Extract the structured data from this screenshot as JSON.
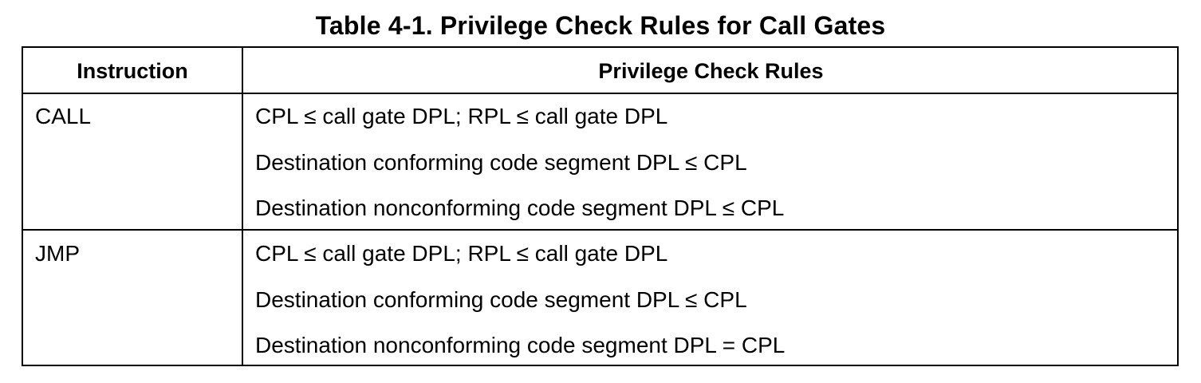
{
  "caption": "Table 4-1.  Privilege Check Rules for Call Gates",
  "table": {
    "headers": {
      "instruction": "Instruction",
      "rules": "Privilege Check Rules"
    },
    "rows": [
      {
        "instruction": "CALL",
        "rules": [
          "CPL ≤ call gate DPL; RPL ≤ call gate DPL",
          "Destination conforming code segment DPL ≤ CPL",
          "Destination nonconforming code segment DPL ≤ CPL"
        ]
      },
      {
        "instruction": "JMP",
        "rules": [
          "CPL ≤ call gate DPL; RPL ≤ call gate DPL",
          "Destination conforming code segment DPL ≤ CPL",
          "Destination nonconforming code segment DPL = CPL"
        ]
      }
    ]
  }
}
